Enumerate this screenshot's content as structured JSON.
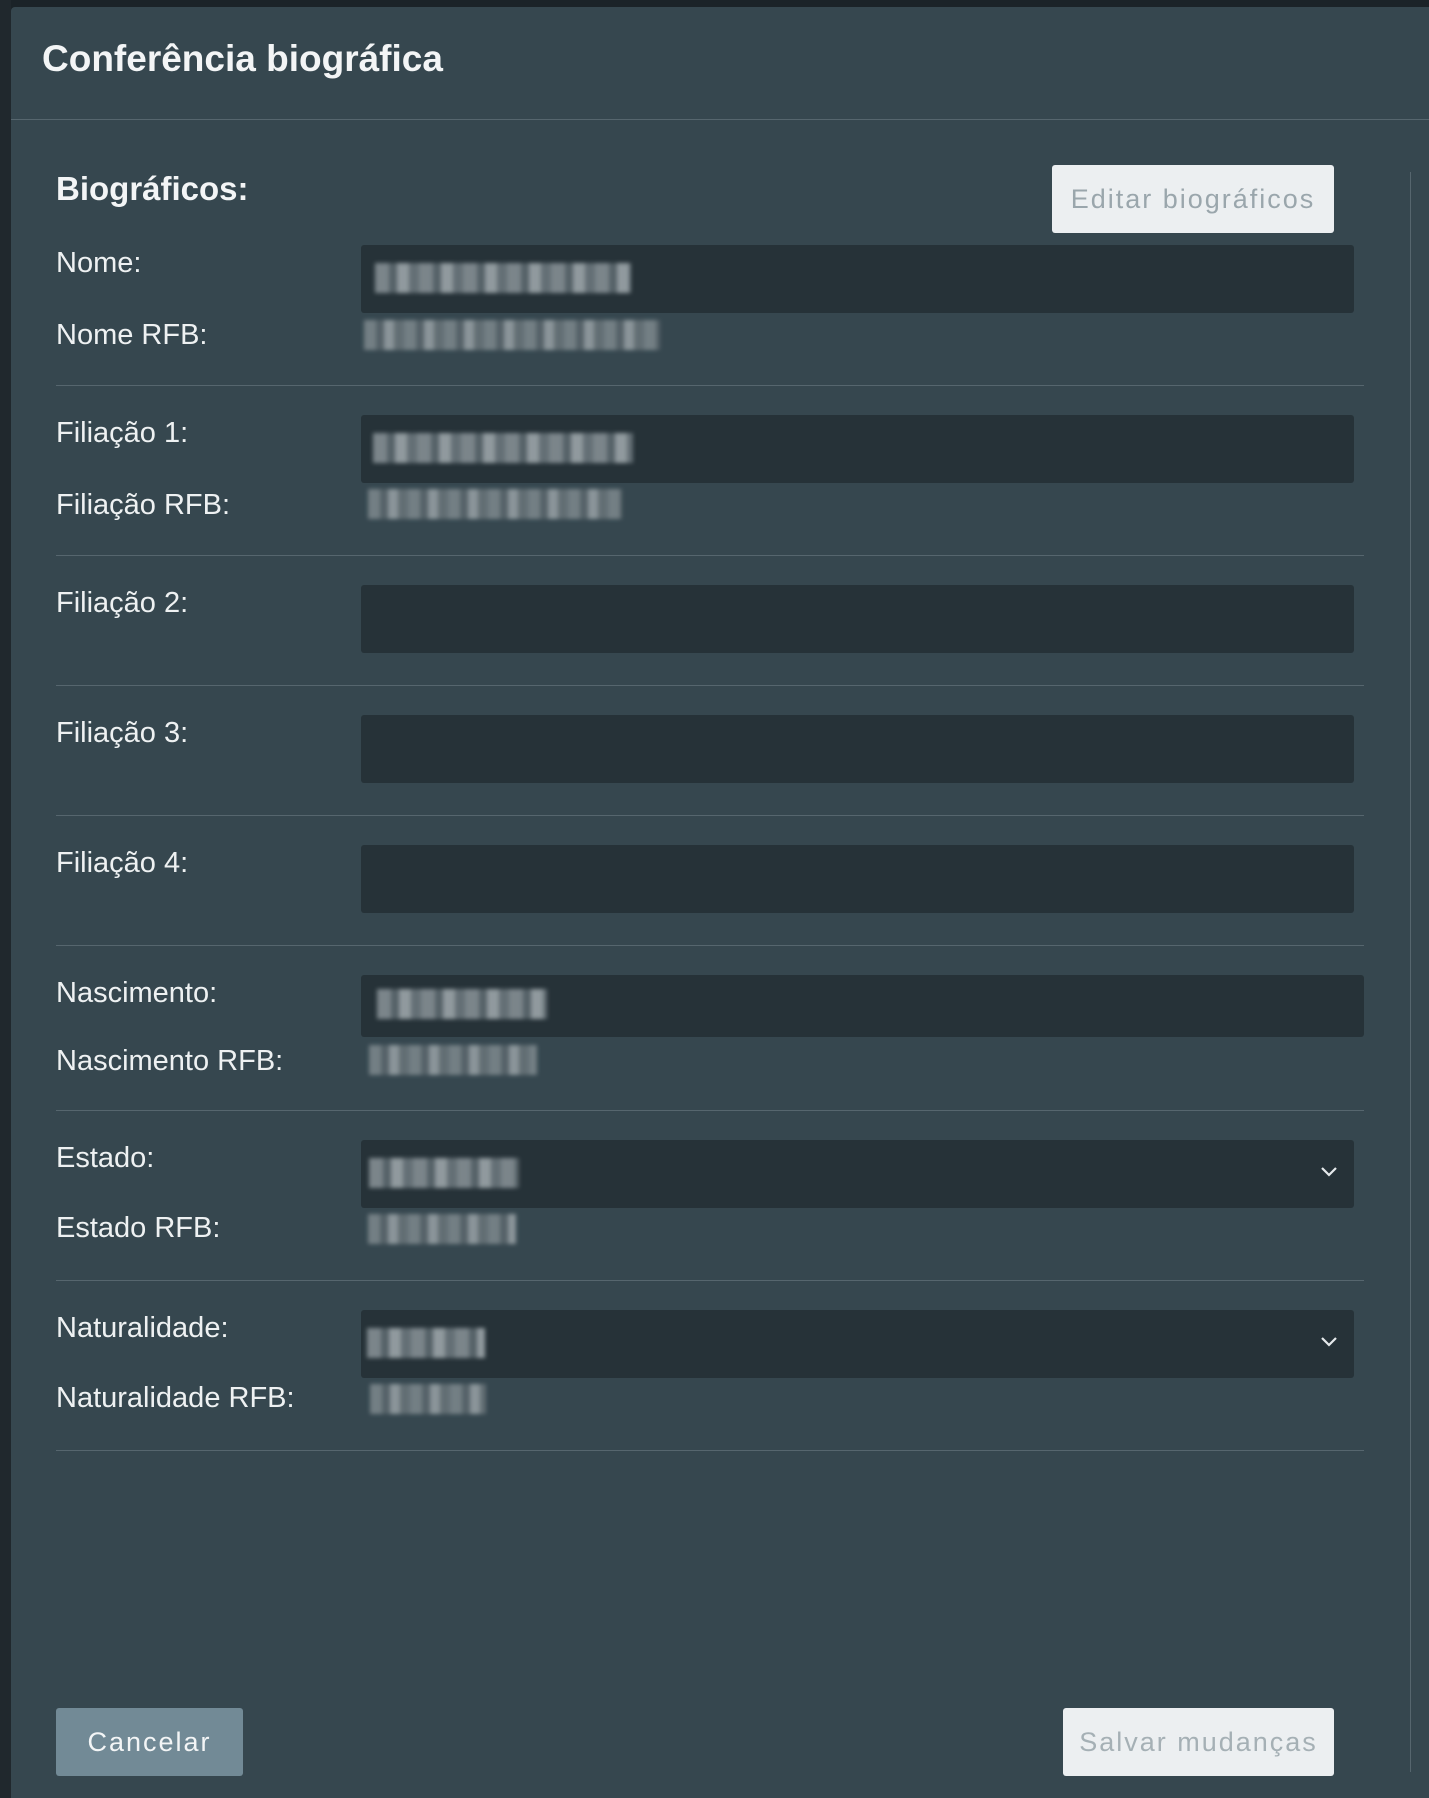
{
  "dialog": {
    "title": "Conferência biográfica"
  },
  "section": {
    "title": "Biográficos:",
    "edit_label": "Editar biográficos"
  },
  "fields": {
    "nome": {
      "label": "Nome:",
      "rfb_label": "Nome RFB:"
    },
    "filiacao1": {
      "label": "Filiação 1:",
      "rfb_label": "Filiação RFB:"
    },
    "filiacao2": {
      "label": "Filiação 2:"
    },
    "filiacao3": {
      "label": "Filiação 3:"
    },
    "filiacao4": {
      "label": "Filiação 4:"
    },
    "nascimento": {
      "label": "Nascimento:",
      "rfb_label": "Nascimento RFB:"
    },
    "estado": {
      "label": "Estado:",
      "rfb_label": "Estado RFB:"
    },
    "naturalidade": {
      "label": "Naturalidade:",
      "rfb_label": "Naturalidade RFB:"
    }
  },
  "footer": {
    "cancel_label": "Cancelar",
    "save_label": "Salvar mudanças"
  },
  "icons": {
    "select_chevron": "chevron-down-icon"
  }
}
